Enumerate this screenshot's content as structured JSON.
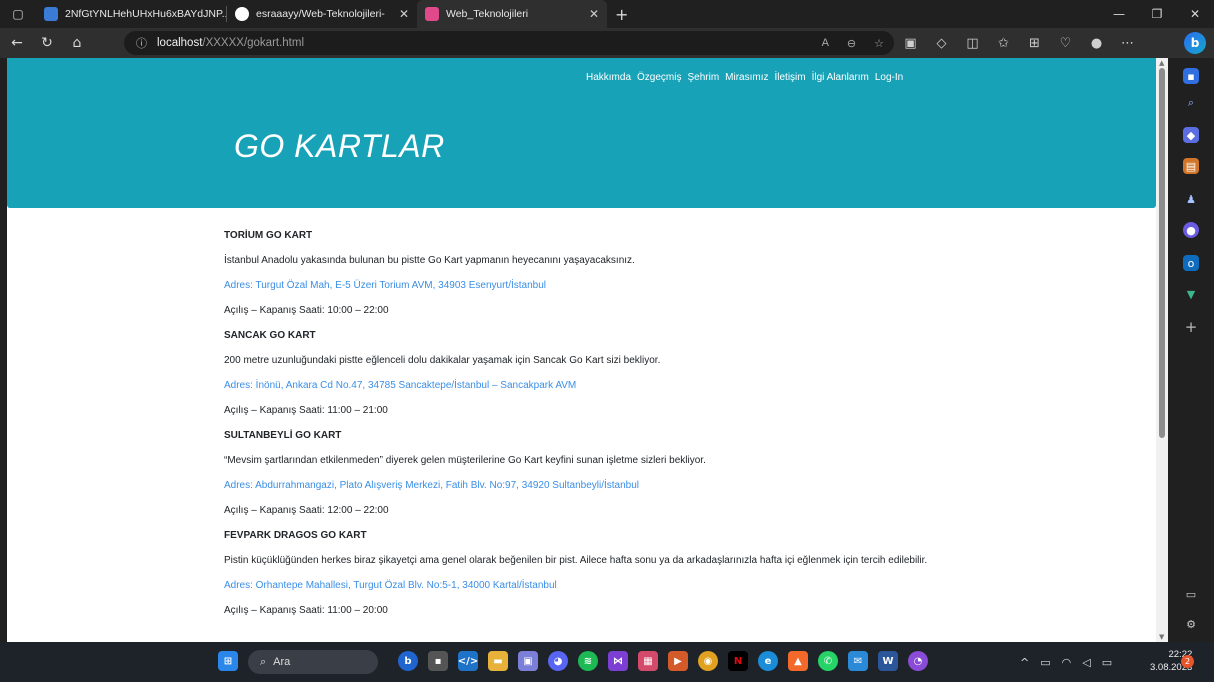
{
  "browser": {
    "tabs": [
      {
        "title": "2NfGtYNLHehUHxHu6xBAYdJNP...",
        "close": "✕",
        "favicon_color": "#3a7bd5"
      },
      {
        "title": "esraaayy/Web-Teknolojileri-",
        "close": "✕",
        "favicon_color": "#ffffff"
      },
      {
        "title": "Web_Teknolojileri",
        "close": "✕",
        "favicon_color": "#e04a8a"
      }
    ],
    "new_tab": "+",
    "url_host": "localhost",
    "url_path": "/XXXXX/gokart.html"
  },
  "page": {
    "nav": [
      "Hakkımda",
      "Özgeçmiş",
      "Şehrim",
      "Mirasımız",
      "İletişim",
      "İlgi Alanlarım",
      "Log-In"
    ],
    "title": "GO KARTLAR",
    "blocks": [
      {
        "title": "TORİUM GO KART",
        "desc": "İstanbul Anadolu yakasında bulunan bu pistte Go Kart yapmanın heyecanını yaşayacaksınız.",
        "address": "Adres: Turgut Özal Mah, E-5 Üzeri Torium AVM, 34903 Esenyurt/İstanbul",
        "hours": "Açılış – Kapanış Saati: 10:00 – 22:00"
      },
      {
        "title": "SANCAK GO KART",
        "desc": "200 metre uzunluğundaki pistte eğlenceli dolu dakikalar yaşamak için Sancak Go Kart sizi bekliyor.",
        "address": "Adres: İnönü, Ankara Cd No.47, 34785 Sancaktepe/İstanbul – Sancakpark AVM",
        "hours": "Açılış – Kapanış Saati: 11:00 – 21:00"
      },
      {
        "title": "SULTANBEYLİ GO KART",
        "desc": "“Mevsim şartlarından etkilenmeden” diyerek gelen müşterilerine Go Kart keyfini sunan işletme sizleri bekliyor.",
        "address": "Adres: Abdurrahmangazi, Plato Alışveriş Merkezi, Fatih Blv. No:97, 34920 Sultanbeyli/İstanbul",
        "hours": "Açılış – Kapanış Saati: 12:00 – 22:00"
      },
      {
        "title": "FEVPARK DRAGOS GO KART",
        "desc": "Pistin küçüklüğünden herkes biraz şikayetçi ama genel olarak beğenilen bir pist. Ailece hafta sonu ya da arkadaşlarınızla hafta içi eğlenmek için tercih edilebilir.",
        "address": "Adres: Orhantepe Mahallesi, Turgut Özal Blv. No:5-1, 34000 Kartal/İstanbul",
        "hours": "Açılış – Kapanış Saati: 11:00 – 20:00"
      }
    ]
  },
  "taskbar": {
    "search_label": "Ara",
    "time": "22:22",
    "date": "3.08.2023",
    "notification_count": "2"
  },
  "colors": {
    "hero": "#17a2b8",
    "link": "#3a8ee6"
  }
}
